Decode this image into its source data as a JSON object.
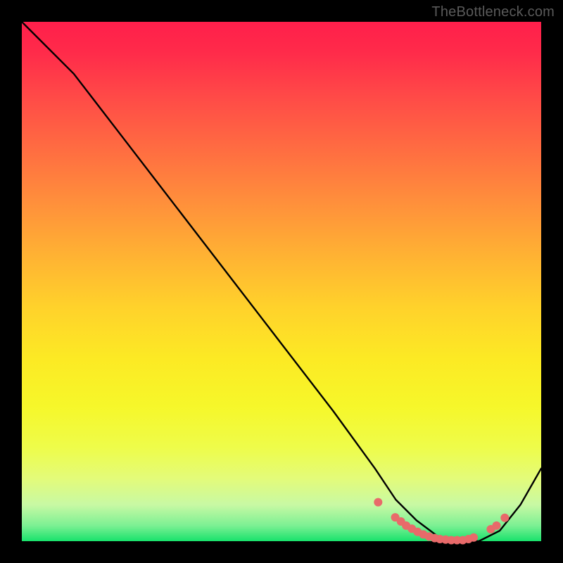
{
  "watermark": "TheBottleneck.com",
  "chart_data": {
    "type": "line",
    "title": "",
    "xlabel": "",
    "ylabel": "",
    "xlim": [
      0,
      100
    ],
    "ylim": [
      0,
      100
    ],
    "grid": false,
    "legend": false,
    "series": [
      {
        "name": "curve",
        "x": [
          0,
          4,
          10,
          20,
          30,
          40,
          50,
          60,
          68,
          72,
          76,
          80,
          84,
          88,
          92,
          96,
          100
        ],
        "y": [
          100,
          96,
          90,
          77,
          64,
          51,
          38,
          25,
          14,
          8,
          4,
          1,
          0,
          0,
          2,
          7,
          14
        ]
      }
    ],
    "markers": {
      "name": "dots",
      "color": "#e86a6a",
      "r": 6,
      "x": [
        68.6,
        71.9,
        73.0,
        74.0,
        75.1,
        76.2,
        77.3,
        78.4,
        79.5,
        80.5,
        81.6,
        82.7,
        83.8,
        84.9,
        86.0,
        87.0,
        90.3,
        91.4,
        93.0
      ],
      "y": [
        7.5,
        4.6,
        3.8,
        3.0,
        2.4,
        1.8,
        1.3,
        0.9,
        0.6,
        0.4,
        0.3,
        0.2,
        0.2,
        0.2,
        0.4,
        0.7,
        2.3,
        3.0,
        4.5
      ]
    },
    "background_gradient": {
      "top": "#ff1f4b",
      "mid": "#ffd22b",
      "bottom": "#18e26c"
    }
  }
}
